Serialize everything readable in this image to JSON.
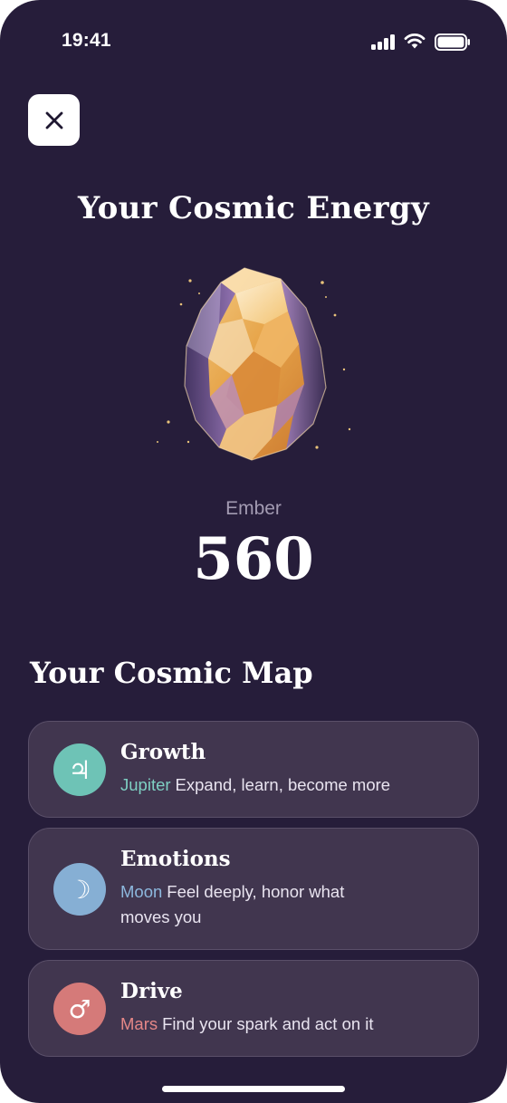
{
  "status_bar": {
    "time": "19:41"
  },
  "header": {
    "close_icon": "close-icon",
    "title": "Your Cosmic Energy"
  },
  "energy": {
    "label": "Ember",
    "value": "560"
  },
  "cosmic_map": {
    "title": "Your Cosmic Map",
    "cards": [
      {
        "title": "Growth",
        "planet": "Jupiter",
        "description": "Expand, learn, become more",
        "symbol": "♃",
        "icon": "jupiter-icon",
        "icon_color": "#6ec3b6",
        "planet_color": "#7ecfc2"
      },
      {
        "title": "Emotions",
        "planet": "Moon",
        "description": "Feel deeply, honor what moves you",
        "symbol": "☽",
        "icon": "moon-icon",
        "icon_color": "#86afd4",
        "planet_color": "#8db8de"
      },
      {
        "title": "Drive",
        "planet": "Mars",
        "description": "Find your spark and act on it",
        "symbol": "♂",
        "icon": "mars-icon",
        "icon_color": "#d57a79",
        "planet_color": "#e58787"
      }
    ]
  },
  "colors": {
    "background": "#261d3a",
    "card_background": "#41364f",
    "label_muted": "#a39bb2"
  }
}
